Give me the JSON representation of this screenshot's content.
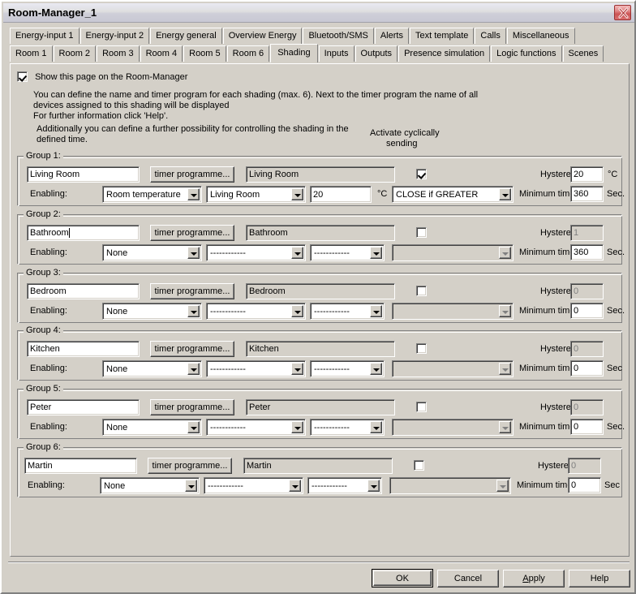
{
  "window": {
    "title": "Room-Manager_1",
    "close_icon": "close-x-icon"
  },
  "tabs": {
    "row1": [
      {
        "label": "Energy-input 1",
        "active": false
      },
      {
        "label": "Energy-input 2",
        "active": false
      },
      {
        "label": "Energy general",
        "active": false
      },
      {
        "label": "Overview Energy",
        "active": false
      },
      {
        "label": "Bluetooth/SMS",
        "active": false
      },
      {
        "label": "Alerts",
        "active": false
      },
      {
        "label": "Text template",
        "active": false
      },
      {
        "label": "Calls",
        "active": false
      },
      {
        "label": "Miscellaneous",
        "active": false
      }
    ],
    "row2": [
      {
        "label": "Room 1",
        "active": false
      },
      {
        "label": "Room 2",
        "active": false
      },
      {
        "label": "Room 3",
        "active": false
      },
      {
        "label": "Room 4",
        "active": false
      },
      {
        "label": "Room 5",
        "active": false
      },
      {
        "label": "Room 6",
        "active": false
      },
      {
        "label": "Shading",
        "active": true
      },
      {
        "label": "Inputs",
        "active": false
      },
      {
        "label": "Outputs",
        "active": false
      },
      {
        "label": "Presence simulation",
        "active": false
      },
      {
        "label": "Logic functions",
        "active": false
      },
      {
        "label": "Scenes",
        "active": false
      }
    ]
  },
  "page": {
    "show_page_checkbox_label": "Show this page on the Room-Manager",
    "show_page_checked": true,
    "description_line1": "You can define the name and timer program for each shading (max. 6). Next to the timer program the name of all",
    "description_line2": "devices assigned to this shading will be displayed",
    "description_line3": "For further information click 'Help'.",
    "description_line4": "Additionally you can define a further possibility for controlling the shading in the",
    "description_line5": "defined time.",
    "cyclic_label_line1": "Activate cyclically",
    "cyclic_label_line2": "sending",
    "enabling_label": "Enabling:",
    "hysteresis_label": "Hysteresis:",
    "minimum_time_label": "Minimum time:",
    "timer_button_label": "timer programme...",
    "unit_celsius": "°C",
    "unit_sec": "Sec.",
    "unit_sec_short": "Sec",
    "placeholder_dashes": "------------"
  },
  "groups": [
    {
      "title": "Group 1:",
      "name_value": "Living Room",
      "name_focused": false,
      "devices_value": "Living Room",
      "cyclic_checked": true,
      "cyclic_enabled": true,
      "hysteresis_value": "20",
      "hysteresis_enabled": true,
      "hysteresis_unit": "°C",
      "source_value": "Room temperature",
      "source_enabled": true,
      "target_value": "Living Room",
      "target_enabled": true,
      "threshold_value": "20",
      "threshold_enabled": true,
      "threshold_unit": "°C",
      "condition_value": "CLOSE if GREATER",
      "condition_enabled": true,
      "min_time_value": "360",
      "min_time_enabled": true,
      "min_time_unit": "Sec."
    },
    {
      "title": "Group 2:",
      "name_value": "Bathroom",
      "name_focused": true,
      "devices_value": "Bathroom",
      "cyclic_checked": false,
      "cyclic_enabled": true,
      "hysteresis_value": "1",
      "hysteresis_enabled": false,
      "hysteresis_unit": "",
      "source_value": "None",
      "source_enabled": true,
      "target_value": "------------",
      "target_enabled": true,
      "threshold_value": "------------",
      "threshold_enabled": true,
      "threshold_unit": "",
      "condition_value": "",
      "condition_enabled": false,
      "min_time_value": "360",
      "min_time_enabled": true,
      "min_time_unit": "Sec."
    },
    {
      "title": "Group 3:",
      "name_value": "Bedroom",
      "name_focused": false,
      "devices_value": "Bedroom",
      "cyclic_checked": false,
      "cyclic_enabled": true,
      "hysteresis_value": "0",
      "hysteresis_enabled": false,
      "hysteresis_unit": "",
      "source_value": "None",
      "source_enabled": true,
      "target_value": "------------",
      "target_enabled": true,
      "threshold_value": "------------",
      "threshold_enabled": true,
      "threshold_unit": "",
      "condition_value": "",
      "condition_enabled": false,
      "min_time_value": "0",
      "min_time_enabled": true,
      "min_time_unit": "Sec."
    },
    {
      "title": "Group 4:",
      "name_value": "Kitchen",
      "name_focused": false,
      "devices_value": "Kitchen",
      "cyclic_checked": false,
      "cyclic_enabled": true,
      "hysteresis_value": "0",
      "hysteresis_enabled": false,
      "hysteresis_unit": "",
      "source_value": "None",
      "source_enabled": true,
      "target_value": "------------",
      "target_enabled": true,
      "threshold_value": "------------",
      "threshold_enabled": true,
      "threshold_unit": "",
      "condition_value": "",
      "condition_enabled": false,
      "min_time_value": "0",
      "min_time_enabled": true,
      "min_time_unit": "Sec"
    },
    {
      "title": "Group 5:",
      "name_value": "Peter",
      "name_focused": false,
      "devices_value": "Peter",
      "cyclic_checked": false,
      "cyclic_enabled": true,
      "hysteresis_value": "0",
      "hysteresis_enabled": false,
      "hysteresis_unit": "",
      "source_value": "None",
      "source_enabled": true,
      "target_value": "------------",
      "target_enabled": true,
      "threshold_value": "------------",
      "threshold_enabled": true,
      "threshold_unit": "",
      "condition_value": "",
      "condition_enabled": false,
      "min_time_value": "0",
      "min_time_enabled": true,
      "min_time_unit": "Sec."
    },
    {
      "title": "Group 6:",
      "name_value": "Martin",
      "name_focused": false,
      "devices_value": "Martin",
      "cyclic_checked": false,
      "cyclic_enabled": true,
      "hysteresis_value": "0",
      "hysteresis_enabled": false,
      "hysteresis_unit": "",
      "source_value": "None",
      "source_enabled": true,
      "target_value": "------------",
      "target_enabled": true,
      "threshold_value": "------------",
      "threshold_enabled": true,
      "threshold_unit": "",
      "condition_value": "",
      "condition_enabled": false,
      "min_time_value": "0",
      "min_time_enabled": true,
      "min_time_unit": "Sec"
    }
  ],
  "buttons": {
    "ok": "OK",
    "cancel": "Cancel",
    "apply_pre": "A",
    "apply_post": "pply",
    "help": "Help"
  },
  "colors": {
    "face": "#d4d0c8",
    "shadow": "#808080",
    "highlight": "#ffffff",
    "close_red": "#cc5555",
    "text": "#000000",
    "disabled_text": "#808080"
  }
}
